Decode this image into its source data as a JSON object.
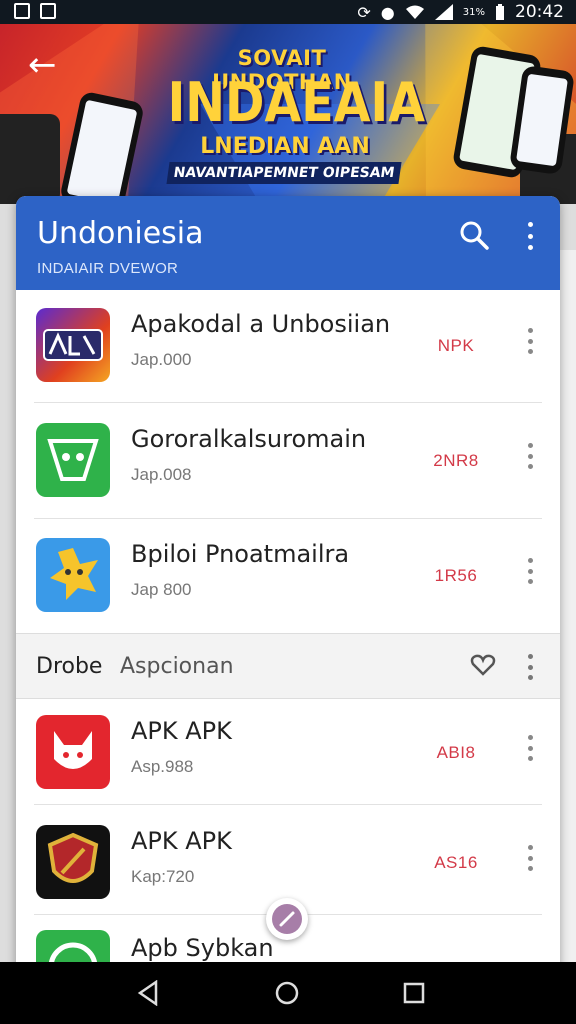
{
  "status_bar": {
    "time": "20:42",
    "battery_text": "31%"
  },
  "banner": {
    "line1": "SOVAIT UNDOTHAN",
    "line2": "INDAEAIA",
    "line3": "LNEDIAN AAN",
    "line4": "NAVANTIAPEMNET OIPESAM"
  },
  "appbar": {
    "title": "Undoniesia",
    "subtitle": "INDAIAIR DVEWOR"
  },
  "apps_top": [
    {
      "name": "Apakodal a Unbosiian",
      "meta": "Jap.000",
      "badge": "NPK"
    },
    {
      "name": "Gororalkalsuromain",
      "meta": "Jap.008",
      "badge": "2NR8"
    },
    {
      "name": "Bpiloi Pnoatmailra",
      "meta": "Jap 800",
      "badge": "1R56"
    }
  ],
  "section": {
    "label1": "Drobe",
    "label2": "Aspcionan"
  },
  "apps_bottom": [
    {
      "name": "APK APK",
      "meta": "Asp.988",
      "badge": "ABI8"
    },
    {
      "name": "APK APK",
      "meta": "Kap:720",
      "badge": "AS16"
    },
    {
      "name": "Apb Sybkan"
    }
  ],
  "colors": {
    "appbar": "#2d63c6",
    "badge": "#d33a48"
  },
  "icons": [
    "back-arrow-icon",
    "search-icon",
    "more-vert-icon",
    "heart-icon",
    "nav-back-icon",
    "nav-home-icon",
    "nav-recents-icon"
  ]
}
